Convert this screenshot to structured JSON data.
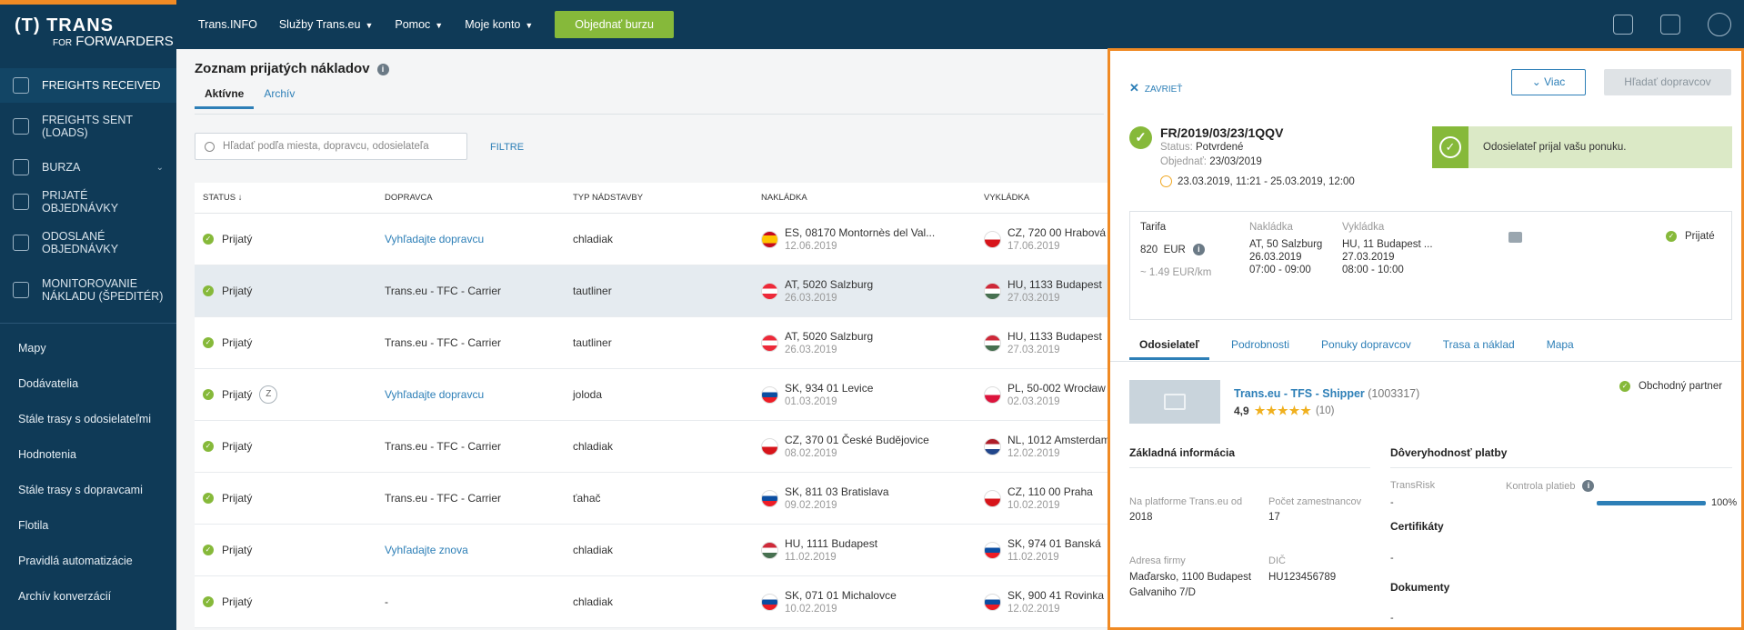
{
  "brand": {
    "line1": "(T) TRANS",
    "line2_small": "FOR",
    "line2": "FORWARDERS"
  },
  "sidebar": {
    "items": [
      {
        "label": "FREIGHTS RECEIVED",
        "icon": "freight-received-icon"
      },
      {
        "label": "FREIGHTS SENT (LOADS)",
        "icon": "freight-sent-icon"
      },
      {
        "label": "BURZA",
        "icon": "box-icon"
      },
      {
        "label": "PRIJATÉ OBJEDNÁVKY",
        "icon": "grid-icon"
      },
      {
        "label": "ODOSLANÉ OBJEDNÁVKY",
        "icon": "link-icon"
      },
      {
        "label": "MONITOROVANIE NÁKLADU (ŠPEDITÉR)",
        "icon": "satellite-icon"
      }
    ],
    "sub_items": [
      "Mapy",
      "Dodávatelia",
      "Stále trasy s odosielateľmi",
      "Hodnotenia",
      "Stále trasy s dopravcami",
      "Flotila",
      "Pravidlá automatizácie",
      "Archív konverzácií"
    ]
  },
  "topbar": {
    "links": [
      "Trans.INFO",
      "Služby Trans.eu",
      "Pomoc",
      "Moje konto"
    ],
    "order_button": "Objednať burzu"
  },
  "page": {
    "title": "Zoznam prijatých nákladov",
    "tabs": [
      "Aktívne",
      "Archív"
    ],
    "search_placeholder": "Hľadať podľa miesta, dopravcu, odosielateľa",
    "filter": "FILTRE"
  },
  "table": {
    "headers": [
      "STATUS ↓",
      "DOPRAVCA",
      "TYP NÁDSTAVBY",
      "NAKLÁDKA",
      "VYKLÁDKA"
    ],
    "rows": [
      {
        "status": "Prijatý",
        "badge": "",
        "carrier": "Vyhľadajte dopravcu",
        "carrier_link": true,
        "body": "chladiak",
        "load_flag": "es",
        "load": "ES, 08170 Montornès del Val...",
        "load_date": "12.06.2019",
        "unload_flag": "cz",
        "unload": "CZ, 720 00 Hrabová",
        "unload_date": "17.06.2019"
      },
      {
        "status": "Prijatý",
        "badge": "",
        "carrier": "Trans.eu - TFC - Carrier",
        "carrier_link": false,
        "body": "tautliner",
        "load_flag": "at",
        "load": "AT, 5020 Salzburg",
        "load_date": "26.03.2019",
        "unload_flag": "hu",
        "unload": "HU, 1133 Budapest",
        "unload_date": "27.03.2019"
      },
      {
        "status": "Prijatý",
        "badge": "",
        "carrier": "Trans.eu - TFC - Carrier",
        "carrier_link": false,
        "body": "tautliner",
        "load_flag": "at",
        "load": "AT, 5020 Salzburg",
        "load_date": "26.03.2019",
        "unload_flag": "hu",
        "unload": "HU, 1133 Budapest",
        "unload_date": "27.03.2019"
      },
      {
        "status": "Prijatý",
        "badge": "Z",
        "carrier": "Vyhľadajte dopravcu",
        "carrier_link": true,
        "body": "joloda",
        "load_flag": "sk",
        "load": "SK, 934 01 Levice",
        "load_date": "01.03.2019",
        "unload_flag": "pl",
        "unload": "PL, 50-002 Wrocław",
        "unload_date": "02.03.2019"
      },
      {
        "status": "Prijatý",
        "badge": "",
        "carrier": "Trans.eu - TFC - Carrier",
        "carrier_link": false,
        "body": "chladiak",
        "load_flag": "cz",
        "load": "CZ, 370 01 České Budějovice",
        "load_date": "08.02.2019",
        "unload_flag": "nl",
        "unload": "NL, 1012 Amsterdam",
        "unload_date": "12.02.2019"
      },
      {
        "status": "Prijatý",
        "badge": "",
        "carrier": "Trans.eu - TFC - Carrier",
        "carrier_link": false,
        "body": "ťahač",
        "load_flag": "sk",
        "load": "SK, 811 03 Bratislava",
        "load_date": "09.02.2019",
        "unload_flag": "cz",
        "unload": "CZ, 110 00 Praha",
        "unload_date": "10.02.2019"
      },
      {
        "status": "Prijatý",
        "badge": "",
        "carrier": "Vyhľadajte znova",
        "carrier_link": true,
        "body": "chladiak",
        "load_flag": "hu",
        "load": "HU, 1111 Budapest",
        "load_date": "11.02.2019",
        "unload_flag": "sk",
        "unload": "SK, 974 01 Banská",
        "unload_date": "11.02.2019"
      },
      {
        "status": "Prijatý",
        "badge": "",
        "carrier": "-",
        "carrier_link": false,
        "body": "chladiak",
        "load_flag": "sk",
        "load": "SK, 071 01 Michalovce",
        "load_date": "10.02.2019",
        "unload_flag": "sk",
        "unload": "SK, 900 41 Rovinka",
        "unload_date": "12.02.2019"
      }
    ]
  },
  "panel": {
    "close": "ZAVRIEŤ",
    "more_button": "Viac",
    "find_button": "Hľadať dopravcov",
    "order_no": "FR/2019/03/23/1QQV",
    "status_label": "Status:",
    "status_value": "Potvrdené",
    "ordered_label": "Objednať:",
    "ordered_value": "23/03/2019",
    "range": "23.03.2019, 11:21 - 25.03.2019, 12:00",
    "accept_message": "Odosielateľ prijal vašu ponuku.",
    "card": {
      "tariff_label": "Tarifa",
      "tariff_value": "820",
      "tariff_currency": "EUR",
      "per_km": "~ 1.49 EUR/km",
      "load_label": "Nakládka",
      "load_place": "AT, 50 Salzburg",
      "load_date": "26.03.2019",
      "load_time": "07:00 - 09:00",
      "unload_label": "Vykládka",
      "unload_place": "HU, 11 Budapest ...",
      "unload_date": "27.03.2019",
      "unload_time": "08:00 - 10:00",
      "accepted": "Prijaté"
    },
    "tabs": [
      "Odosielateľ",
      "Podrobnosti",
      "Ponuky dopravcov",
      "Trasa a náklad",
      "Mapa"
    ],
    "company": {
      "name": "Trans.eu - TFS - Shipper",
      "id": "(1003317)",
      "rating": "4,9",
      "stars": "★★★★★",
      "reviews": "(10)",
      "partner": "Obchodný partner"
    },
    "basic_info": {
      "title": "Základná informácia",
      "since_label": "Na platforme Trans.eu od",
      "since_value": "2018",
      "employees_label": "Počet zamestnancov",
      "employees_value": "17",
      "address_label": "Adresa firmy",
      "address_line1": "Maďarsko, 1100 Budapest",
      "address_line2": "Galvaniho 7/D",
      "vat_label": "DIČ",
      "vat_value": "HU123456789"
    },
    "payment": {
      "title": "Dôveryhodnosť platby",
      "transrisk_label": "TransRisk",
      "transrisk_value": "-",
      "control_label": "Kontrola platieb",
      "control_pct": "100%",
      "certs_title": "Certifikáty",
      "certs_value": "-",
      "docs_title": "Dokumenty",
      "docs_value": "-"
    }
  },
  "colors": {
    "navy": "#0f3a57",
    "accent_orange": "#f08a24",
    "green": "#86b93a",
    "link_blue": "#2d7fb7"
  }
}
